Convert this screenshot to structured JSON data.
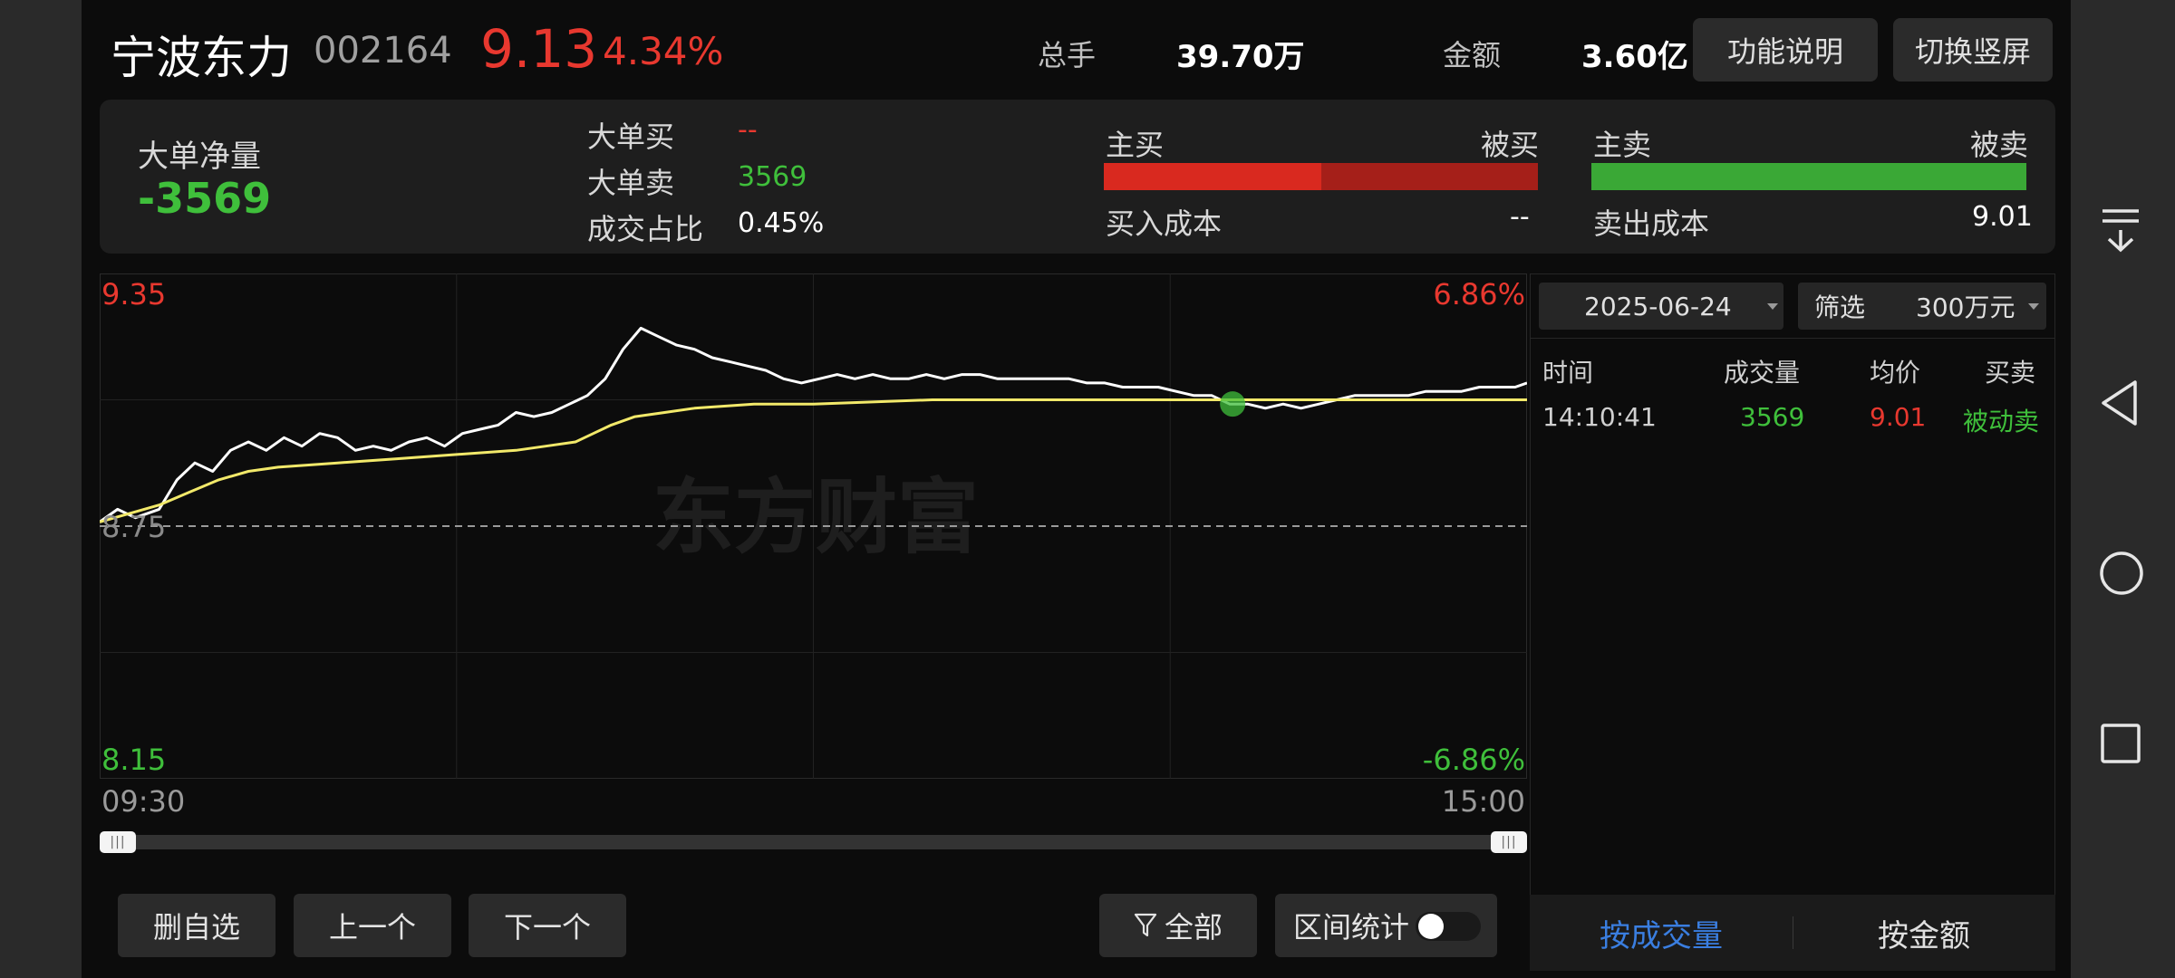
{
  "header": {
    "name": "宁波东力",
    "code": "002164",
    "price": "9.13",
    "change_pct": "4.34%",
    "volume_label": "总手",
    "volume_value": "39.70万",
    "amount_label": "金额",
    "amount_value": "3.60亿",
    "btn_help": "功能说明",
    "btn_portrait": "切换竖屏"
  },
  "summary": {
    "net_label": "大单净量",
    "net_value": "-3569",
    "big_buy_label": "大单买",
    "big_buy_value": "--",
    "big_sell_label": "大单卖",
    "big_sell_value": "3569",
    "ratio_label": "成交占比",
    "ratio_value": "0.45%",
    "active_buy_label": "主买",
    "passive_buy_label": "被买",
    "buy_cost_label": "买入成本",
    "buy_cost_value": "--",
    "active_sell_label": "主卖",
    "passive_sell_label": "被卖",
    "sell_cost_label": "卖出成本",
    "sell_cost_value": "9.01",
    "buy_bar_active_fraction": 0.5,
    "sell_bar_active_fraction": 0.0
  },
  "chart": {
    "price_high": "9.35",
    "price_low": "8.15",
    "pct_high": "6.86%",
    "pct_low": "-6.86%",
    "prev_close": "8.75",
    "time_start": "09:30",
    "time_end": "15:00",
    "watermark": "东方财富"
  },
  "chart_data": {
    "type": "line",
    "ylim": [
      8.15,
      9.35
    ],
    "xlim": [
      0,
      240
    ],
    "prev_close": 8.75,
    "x_ticks": [
      "09:30",
      "15:00"
    ],
    "series": [
      {
        "color": "#ffffff",
        "points": [
          [
            0,
            8.76
          ],
          [
            3,
            8.79
          ],
          [
            6,
            8.77
          ],
          [
            10,
            8.79
          ],
          [
            13,
            8.86
          ],
          [
            16,
            8.9
          ],
          [
            19,
            8.88
          ],
          [
            22,
            8.93
          ],
          [
            25,
            8.95
          ],
          [
            28,
            8.93
          ],
          [
            31,
            8.96
          ],
          [
            34,
            8.94
          ],
          [
            37,
            8.97
          ],
          [
            40,
            8.96
          ],
          [
            43,
            8.93
          ],
          [
            46,
            8.94
          ],
          [
            49,
            8.93
          ],
          [
            52,
            8.95
          ],
          [
            55,
            8.96
          ],
          [
            58,
            8.94
          ],
          [
            61,
            8.97
          ],
          [
            64,
            8.98
          ],
          [
            67,
            8.99
          ],
          [
            70,
            9.02
          ],
          [
            73,
            9.01
          ],
          [
            76,
            9.02
          ],
          [
            79,
            9.04
          ],
          [
            82,
            9.06
          ],
          [
            85,
            9.1
          ],
          [
            88,
            9.17
          ],
          [
            91,
            9.22
          ],
          [
            94,
            9.2
          ],
          [
            97,
            9.18
          ],
          [
            100,
            9.17
          ],
          [
            103,
            9.15
          ],
          [
            106,
            9.14
          ],
          [
            109,
            9.13
          ],
          [
            112,
            9.12
          ],
          [
            115,
            9.1
          ],
          [
            118,
            9.09
          ],
          [
            121,
            9.1
          ],
          [
            124,
            9.11
          ],
          [
            127,
            9.1
          ],
          [
            130,
            9.11
          ],
          [
            133,
            9.1
          ],
          [
            136,
            9.1
          ],
          [
            139,
            9.11
          ],
          [
            142,
            9.1
          ],
          [
            145,
            9.11
          ],
          [
            148,
            9.11
          ],
          [
            151,
            9.1
          ],
          [
            154,
            9.1
          ],
          [
            157,
            9.1
          ],
          [
            160,
            9.1
          ],
          [
            163,
            9.1
          ],
          [
            166,
            9.09
          ],
          [
            169,
            9.09
          ],
          [
            172,
            9.08
          ],
          [
            175,
            9.08
          ],
          [
            178,
            9.08
          ],
          [
            181,
            9.07
          ],
          [
            184,
            9.06
          ],
          [
            187,
            9.06
          ],
          [
            190,
            9.04
          ],
          [
            193,
            9.04
          ],
          [
            196,
            9.03
          ],
          [
            199,
            9.04
          ],
          [
            202,
            9.03
          ],
          [
            205,
            9.04
          ],
          [
            208,
            9.05
          ],
          [
            211,
            9.06
          ],
          [
            214,
            9.06
          ],
          [
            217,
            9.06
          ],
          [
            220,
            9.06
          ],
          [
            223,
            9.07
          ],
          [
            226,
            9.07
          ],
          [
            229,
            9.07
          ],
          [
            232,
            9.08
          ],
          [
            235,
            9.08
          ],
          [
            238,
            9.08
          ],
          [
            240,
            9.09
          ]
        ]
      },
      {
        "color": "#f2e96a",
        "points": [
          [
            0,
            8.76
          ],
          [
            5,
            8.78
          ],
          [
            10,
            8.8
          ],
          [
            15,
            8.83
          ],
          [
            20,
            8.86
          ],
          [
            25,
            8.88
          ],
          [
            30,
            8.89
          ],
          [
            40,
            8.9
          ],
          [
            50,
            8.91
          ],
          [
            60,
            8.92
          ],
          [
            70,
            8.93
          ],
          [
            75,
            8.94
          ],
          [
            80,
            8.95
          ],
          [
            83,
            8.97
          ],
          [
            86,
            8.99
          ],
          [
            90,
            9.01
          ],
          [
            95,
            9.02
          ],
          [
            100,
            9.03
          ],
          [
            110,
            9.04
          ],
          [
            120,
            9.04
          ],
          [
            140,
            9.05
          ],
          [
            160,
            9.05
          ],
          [
            180,
            9.05
          ],
          [
            200,
            9.05
          ],
          [
            220,
            9.05
          ],
          [
            240,
            9.05
          ]
        ]
      }
    ],
    "marker": {
      "x": 190.5,
      "y": 9.04,
      "color": "#3fbf3b"
    }
  },
  "side": {
    "date": "2025-06-24",
    "filter_label": "筛选",
    "filter_value": "300万元",
    "col_time": "时间",
    "col_volume": "成交量",
    "col_price": "均价",
    "col_side": "买卖",
    "rows": [
      {
        "time": "14:10:41",
        "volume": "3569",
        "price": "9.01",
        "side": "被动卖"
      }
    ],
    "tab_volume": "按成交量",
    "tab_amount": "按金额"
  },
  "footer": {
    "btn_delete": "删自选",
    "btn_prev": "上一个",
    "btn_next": "下一个",
    "btn_all": "全部",
    "range_stats_label": "区间统计",
    "range_stats_on": false
  },
  "colors": {
    "up": "#e8382f",
    "down": "#3fbf3b",
    "avg_line": "#f2e96a",
    "tab_active": "#3a7ee0"
  }
}
